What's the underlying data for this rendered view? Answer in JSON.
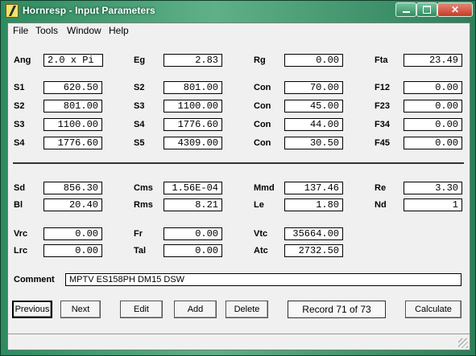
{
  "window": {
    "title": "Hornresp - Input Parameters",
    "accent": "#2e8a5f"
  },
  "menu": [
    "File",
    "Tools",
    "Window",
    "Help"
  ],
  "params": {
    "Ang": "2.0 x Pi",
    "Eg": "2.83",
    "Rg": "0.00",
    "Fta": "23.49",
    "S1": "620.50",
    "S2_a": "801.00",
    "Con_1": "70.00",
    "F12": "0.00",
    "S2_b": "801.00",
    "S3_a": "1100.00",
    "Con_2": "45.00",
    "F23": "0.00",
    "S3_b": "1100.00",
    "S4_a": "1776.60",
    "Con_3": "44.00",
    "F34": "0.00",
    "S4_b": "1776.60",
    "S5": "4309.00",
    "Con_4": "30.50",
    "F45": "0.00",
    "Sd": "856.30",
    "Cms": "1.56E-04",
    "Mmd": "137.46",
    "Re": "3.30",
    "Bl": "20.40",
    "Rms": "8.21",
    "Le": "1.80",
    "Nd": "1",
    "Vrc": "0.00",
    "Fr": "0.00",
    "Vtc": "35664.00",
    "Lrc": "0.00",
    "Tal": "0.00",
    "Atc": "2732.50"
  },
  "labels": {
    "Ang": "Ang",
    "Eg": "Eg",
    "Rg": "Rg",
    "Fta": "Fta",
    "S1": "S1",
    "S2": "S2",
    "S3": "S3",
    "S4": "S4",
    "S5": "S5",
    "Con": "Con",
    "F12": "F12",
    "F23": "F23",
    "F34": "F34",
    "F45": "F45",
    "Sd": "Sd",
    "Cms": "Cms",
    "Mmd": "Mmd",
    "Re": "Re",
    "Bl": "Bl",
    "Rms": "Rms",
    "Le": "Le",
    "Nd": "Nd",
    "Vrc": "Vrc",
    "Fr": "Fr",
    "Vtc": "Vtc",
    "Lrc": "Lrc",
    "Tal": "Tal",
    "Atc": "Atc",
    "Comment": "Comment"
  },
  "comment": "MPTV ES158PH DM15 DSW",
  "buttons": {
    "previous": "Previous",
    "next": "Next",
    "edit": "Edit",
    "add": "Add",
    "delete": "Delete",
    "calculate": "Calculate"
  },
  "record": "Record 71 of 73"
}
